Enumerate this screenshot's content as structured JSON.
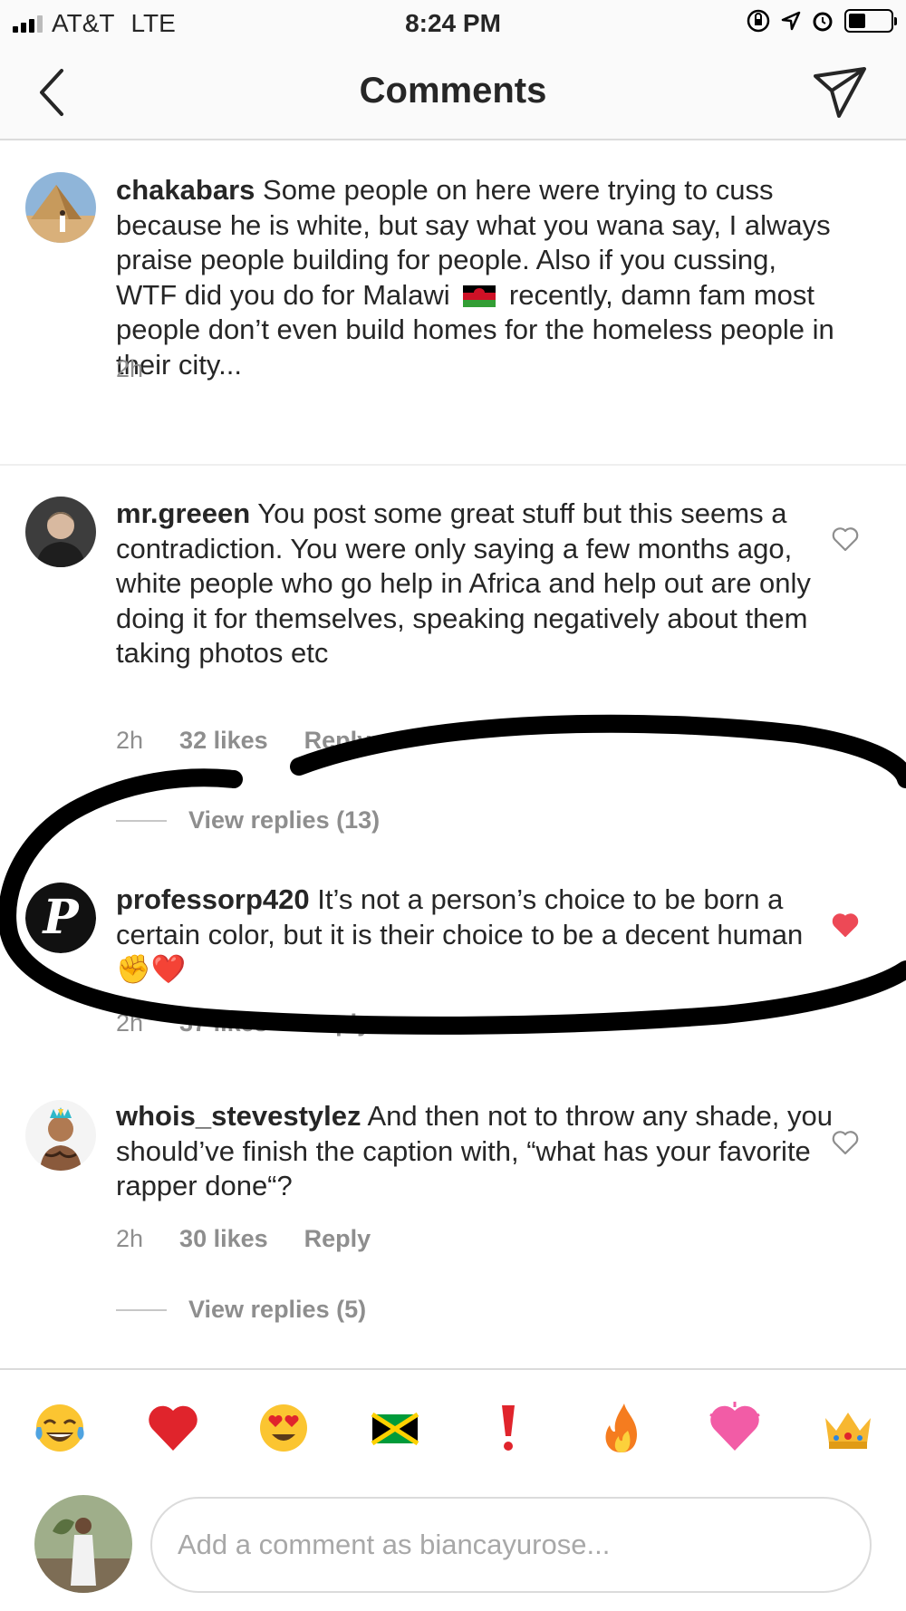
{
  "status_bar": {
    "carrier": "AT&T",
    "network": "LTE",
    "time": "8:24 PM"
  },
  "header": {
    "title": "Comments"
  },
  "comments": [
    {
      "username": "chakabars",
      "text": "Some people on here were trying to cuss because he is white, but say what you wana say, I always praise people building for people. Also if you cussing, WTF did you do for Malawi",
      "text_after_flag": "recently, damn fam most people don’t even build homes for the homeless people in their city...",
      "time": "2h"
    },
    {
      "username": "mr.greeen",
      "text": "You post some great stuff but this seems a contradiction. You were only saying a few months ago, white people who go help in Africa and help out are only doing it for themselves, speaking negatively about them taking photos etc",
      "time": "2h",
      "likes": "32 likes",
      "reply": "Reply",
      "liked": false,
      "view_replies": "View replies (13)"
    },
    {
      "username": "professorp420",
      "text": "It’s not a person’s choice to be born a certain color, but it is their choice to be a decent human ✊❤️",
      "time": "2h",
      "likes": "37 likes",
      "reply": "Reply",
      "liked": true
    },
    {
      "username": "whois_stevestylez",
      "text": "And then not to throw any shade, you should’ve finish the caption with, “what has your favorite rapper done“?",
      "time": "2h",
      "likes": "30 likes",
      "reply": "Reply",
      "liked": false,
      "view_replies": "View replies (5)"
    }
  ],
  "emoji_bar": [
    "😂",
    "❤️",
    "😍",
    "🇯🇲",
    "❗",
    "🔥",
    "💗",
    "👑"
  ],
  "composer": {
    "placeholder": "Add a comment as biancayurose..."
  },
  "colors": {
    "text": "#262626",
    "meta": "#8e8e8e",
    "liked_heart": "#ed4956",
    "divider": "#efefef"
  }
}
